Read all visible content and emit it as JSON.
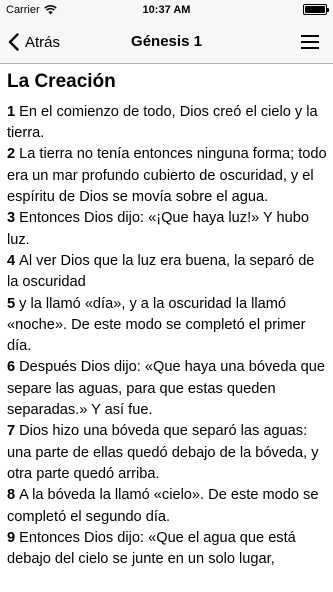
{
  "status_bar": {
    "carrier": "Carrier",
    "time": "10:37 AM"
  },
  "nav": {
    "back_label": "Atrás",
    "title": "Génesis 1"
  },
  "chapter": {
    "heading": "La Creación",
    "verses": [
      {
        "num": "1",
        "text": "En el comienzo de todo, Dios creó el cielo y la tierra."
      },
      {
        "num": "2",
        "text": "La tierra no tenía entonces ninguna forma; todo era un mar profundo cubierto de oscuridad, y el espíritu de Dios se movía sobre el agua."
      },
      {
        "num": "3",
        "text": "Entonces Dios dijo: «¡Que haya luz!» Y hubo luz."
      },
      {
        "num": "4",
        "text": "Al ver Dios que la luz era buena, la separó de la oscuridad"
      },
      {
        "num": "5",
        "text": "y la llamó «día», y a la oscuridad la llamó «noche». De este modo se completó el primer día."
      },
      {
        "num": "6",
        "text": "Después Dios dijo: «Que haya una bóveda que separe las aguas, para que estas queden separadas.» Y así fue."
      },
      {
        "num": "7",
        "text": "Dios hizo una bóveda que separó las aguas: una parte de ellas quedó debajo de la bóveda, y otra parte quedó arriba."
      },
      {
        "num": "8",
        "text": "A la bóveda la llamó «cielo». De este modo se completó el segundo día."
      },
      {
        "num": "9",
        "text": "Entonces Dios dijo: «Que el agua que está debajo del cielo se junte en un solo lugar,"
      }
    ]
  }
}
